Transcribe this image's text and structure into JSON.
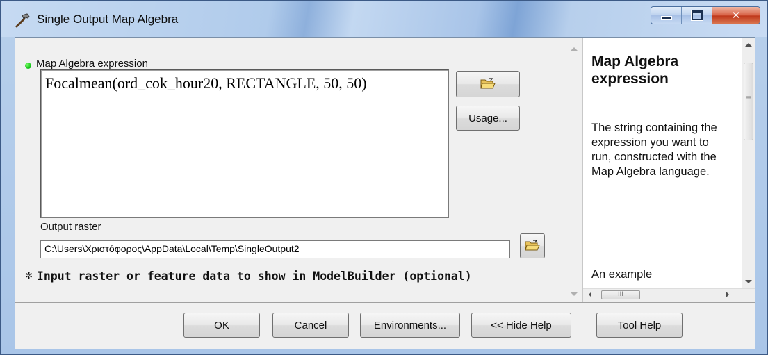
{
  "window": {
    "title": "Single Output Map Algebra",
    "icon": "hammer-icon"
  },
  "caption_buttons": {
    "minimize": "minimize-icon",
    "maximize": "maximize-icon",
    "close": "close-icon"
  },
  "form": {
    "expression_label": "Map Algebra expression",
    "expression_value": "Focalmean(ord_cok_hour20, RECTANGLE, 50, 50)",
    "open_folder_icon": "open-folder-icon",
    "usage_button": "Usage...",
    "output_label": "Output raster",
    "output_value": "C:\\Users\\Χριστόφορος\\AppData\\Local\\Temp\\SingleOutput2",
    "optional_section": "Input raster or feature data to show in ModelBuilder (optional)",
    "optional_chevron": "»"
  },
  "help": {
    "title": "Map Algebra expression",
    "body": "The string containing the expression you want to run, constructed with the Map Algebra language.",
    "example_start": "An example"
  },
  "footer": {
    "ok": "OK",
    "cancel": "Cancel",
    "environments": "Environments...",
    "hide_help": "<< Hide Help",
    "tool_help": "Tool Help"
  },
  "colors": {
    "required_indicator": "#17c71a",
    "titlebar": "#b7cfeb",
    "close_button": "#c0391c"
  }
}
